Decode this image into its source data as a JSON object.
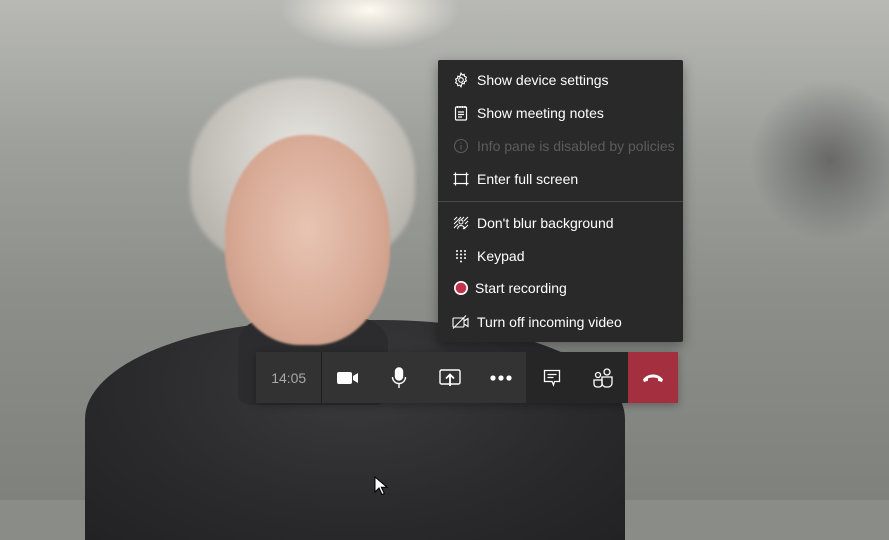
{
  "menu": {
    "items": [
      {
        "label": "Show device settings",
        "icon": "gear-icon",
        "disabled": false
      },
      {
        "label": "Show meeting notes",
        "icon": "notes-icon",
        "disabled": false
      },
      {
        "label": "Info pane is disabled by policies",
        "icon": "info-icon",
        "disabled": true
      },
      {
        "label": "Enter full screen",
        "icon": "fullscreen-icon",
        "disabled": false
      },
      {
        "label": "Don't blur background",
        "icon": "blur-background-icon",
        "disabled": false
      },
      {
        "label": "Keypad",
        "icon": "keypad-icon",
        "disabled": false
      },
      {
        "label": "Start recording",
        "icon": "record-icon",
        "disabled": false
      },
      {
        "label": "Turn off incoming video",
        "icon": "video-off-icon",
        "disabled": false
      }
    ]
  },
  "toolbar": {
    "call_time": "14:05",
    "buttons": [
      {
        "name": "camera",
        "icon": "camera-icon"
      },
      {
        "name": "microphone",
        "icon": "microphone-icon"
      },
      {
        "name": "share-screen",
        "icon": "share-screen-icon"
      },
      {
        "name": "more-actions",
        "icon": "more-icon"
      },
      {
        "name": "chat",
        "icon": "chat-icon"
      },
      {
        "name": "participants",
        "icon": "participants-icon"
      },
      {
        "name": "hang-up",
        "icon": "hang-up-icon"
      }
    ]
  },
  "colors": {
    "menu_bg": "#292929",
    "hangup": "#a4303f",
    "record": "#c4314b",
    "disabled_text": "#5c5c5c"
  }
}
